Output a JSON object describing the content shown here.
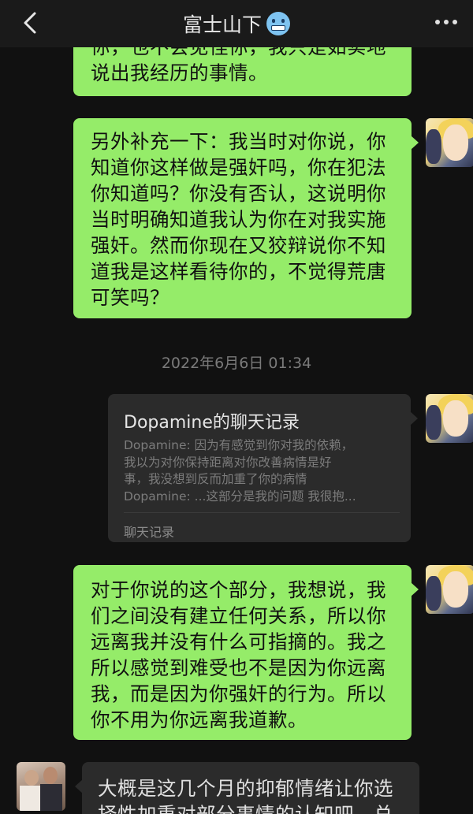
{
  "header": {
    "title": "富士山下",
    "back_icon": "chevron-left-icon",
    "title_emoji": "cold-face-emoji",
    "more_icon": "more-dots-icon"
  },
  "messages": [
    {
      "side": "right",
      "lines": [
        "你，也不会见怪你，我只是如实地",
        "说出我经历的事情。"
      ]
    },
    {
      "side": "right",
      "lines": [
        "另外补充一下：我当时对你说，你",
        "知道你这样做是强奸吗，你在犯法",
        "你知道吗？你没有否认，这说明你",
        "当时明确知道我认为你在对我实施",
        "强奸。然而你现在又狡辩说你不知",
        "道我是这样看待你的，不觉得荒唐",
        "可笑吗？"
      ]
    },
    {
      "side": "right",
      "lines": [
        "对于你说的这个部分，我想说，我",
        "们之间没有建立任何关系，所以你",
        "远离我并没有什么可指摘的。我之",
        "所以感觉到难受也不是因为你远离",
        "我，而是因为你强奸的行为。所以",
        "你不用为你远离我道歉。"
      ]
    },
    {
      "side": "left",
      "lines": [
        "大概是这几个月的抑郁情绪让你选",
        "择性加重对部分事情的认知吧，总"
      ]
    }
  ],
  "timestamp": "2022年6月6日 01:34",
  "chat_record": {
    "title": "Dopamine的聊天记录",
    "lines": [
      "Dopamine: 因为有感觉到你对我的依赖，",
      "我以为对你保持距离对你改善病情是好",
      "事，我没想到反而加重了你的病情",
      "Dopamine: ...这部分是我的问题 我很抱..."
    ],
    "footer": "聊天记录"
  },
  "colors": {
    "background": "#111111",
    "header": "#1a1a1a",
    "bubble_green": "#95ec69",
    "bubble_gray": "#2b2b2b"
  }
}
